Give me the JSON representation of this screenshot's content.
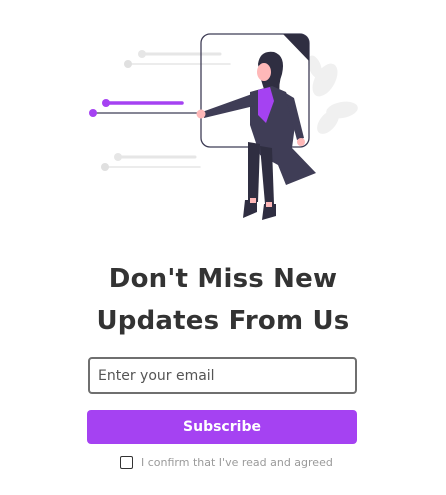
{
  "heading": {
    "line1": "Don't Miss New",
    "line2": "Updates From Us"
  },
  "form": {
    "email_placeholder": "Enter your email",
    "email_value": "",
    "subscribe_label": "Subscribe",
    "consent_label": "I confirm that I've read and agreed",
    "consent_checked": false
  },
  "colors": {
    "accent": "#a542f2",
    "heading": "#333333",
    "muted": "#9a9a9a"
  },
  "illustration": {
    "icon": "woman-pulling-slider-illustration"
  }
}
